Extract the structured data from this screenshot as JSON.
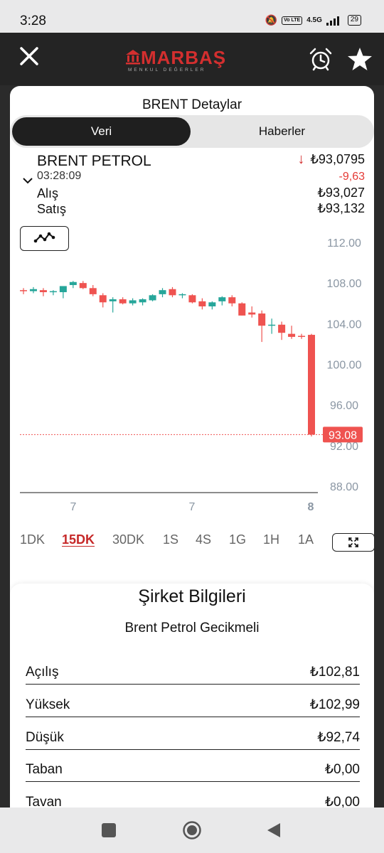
{
  "status_bar": {
    "time": "3:28",
    "network": "4.5G",
    "volte": "Vo LTE",
    "battery": "29"
  },
  "header": {
    "logo_text": "MARBAŞ",
    "logo_sub": "MENKUL DEĞERLER",
    "icons": [
      "close-icon",
      "alarm-clock-icon",
      "star-icon"
    ]
  },
  "sheet": {
    "title": "BRENT Detaylar",
    "tabs": [
      {
        "label": "Veri",
        "active": true
      },
      {
        "label": "Haberler",
        "active": false
      }
    ]
  },
  "quote": {
    "symbol": "BRENT PETROL",
    "time": "03:28:09",
    "price": "₺93,0795",
    "change": "-9,63",
    "alis_label": "Alış",
    "alis_value": "₺93,027",
    "satis_label": "Satış",
    "satis_value": "₺93,132"
  },
  "colors": {
    "up": "#26a69a",
    "down": "#ef5350",
    "accent_red": "#c62828"
  },
  "chart_data": {
    "type": "candlestick",
    "y_ticks": [
      "112.00",
      "108.00",
      "104.00",
      "100.00",
      "96.00",
      "92.00",
      "88.00"
    ],
    "ylim": [
      88,
      112
    ],
    "x_ticks": [
      "7",
      "7",
      "8"
    ],
    "last_price_label": "93.08",
    "last_price": 93.08,
    "candles": [
      {
        "o": 107.3,
        "h": 107.5,
        "l": 106.9,
        "c": 107.2
      },
      {
        "o": 107.2,
        "h": 107.6,
        "l": 107.0,
        "c": 107.4
      },
      {
        "o": 107.3,
        "h": 107.5,
        "l": 106.7,
        "c": 107.1
      },
      {
        "o": 107.1,
        "h": 107.3,
        "l": 106.8,
        "c": 107.2
      },
      {
        "o": 107.1,
        "h": 107.6,
        "l": 106.5,
        "c": 107.7
      },
      {
        "o": 107.8,
        "h": 108.2,
        "l": 107.5,
        "c": 108.1
      },
      {
        "o": 108.0,
        "h": 108.2,
        "l": 107.4,
        "c": 107.5
      },
      {
        "o": 107.5,
        "h": 107.8,
        "l": 106.7,
        "c": 106.9
      },
      {
        "o": 106.8,
        "h": 107.0,
        "l": 105.6,
        "c": 106.1
      },
      {
        "o": 106.2,
        "h": 106.6,
        "l": 105.1,
        "c": 106.4
      },
      {
        "o": 106.4,
        "h": 106.6,
        "l": 105.9,
        "c": 106.0
      },
      {
        "o": 106.0,
        "h": 106.5,
        "l": 105.8,
        "c": 106.3
      },
      {
        "o": 106.1,
        "h": 106.5,
        "l": 105.8,
        "c": 106.4
      },
      {
        "o": 106.3,
        "h": 106.9,
        "l": 106.2,
        "c": 106.8
      },
      {
        "o": 106.9,
        "h": 107.5,
        "l": 106.6,
        "c": 107.3
      },
      {
        "o": 107.4,
        "h": 107.6,
        "l": 106.6,
        "c": 106.8
      },
      {
        "o": 106.8,
        "h": 107.0,
        "l": 106.5,
        "c": 106.9
      },
      {
        "o": 106.8,
        "h": 106.9,
        "l": 106.0,
        "c": 106.1
      },
      {
        "o": 106.2,
        "h": 106.5,
        "l": 105.4,
        "c": 105.7
      },
      {
        "o": 105.7,
        "h": 106.2,
        "l": 105.4,
        "c": 106.1
      },
      {
        "o": 106.2,
        "h": 106.7,
        "l": 105.8,
        "c": 106.6
      },
      {
        "o": 106.6,
        "h": 106.8,
        "l": 105.7,
        "c": 106.0
      },
      {
        "o": 106.0,
        "h": 106.1,
        "l": 104.8,
        "c": 104.8
      },
      {
        "o": 105.1,
        "h": 105.7,
        "l": 104.6,
        "c": 104.9
      },
      {
        "o": 105.0,
        "h": 105.3,
        "l": 102.2,
        "c": 103.8
      },
      {
        "o": 103.9,
        "h": 104.5,
        "l": 103.0,
        "c": 103.9
      },
      {
        "o": 103.9,
        "h": 104.2,
        "l": 102.4,
        "c": 103.1
      },
      {
        "o": 103.0,
        "h": 103.8,
        "l": 102.5,
        "c": 102.7
      },
      {
        "o": 102.8,
        "h": 103.0,
        "l": 102.5,
        "c": 102.7
      },
      {
        "o": 102.9,
        "h": 103.0,
        "l": 92.9,
        "c": 93.08
      }
    ]
  },
  "timeframes": [
    {
      "label": "1DK",
      "active": false
    },
    {
      "label": "15DK",
      "active": true
    },
    {
      "label": "30DK",
      "active": false
    },
    {
      "label": "1S",
      "active": false
    },
    {
      "label": "4S",
      "active": false
    },
    {
      "label": "1G",
      "active": false
    },
    {
      "label": "1H",
      "active": false
    },
    {
      "label": "1A",
      "active": false
    }
  ],
  "company_info": {
    "title": "Şirket Bilgileri",
    "subtitle": "Brent Petrol Gecikmeli",
    "rows": [
      {
        "label": "Açılış",
        "value": "₺102,81"
      },
      {
        "label": "Yüksek",
        "value": "₺102,99"
      },
      {
        "label": "Düşük",
        "value": "₺92,74"
      },
      {
        "label": "Taban",
        "value": "₺0,00"
      },
      {
        "label": "Tavan",
        "value": "₺0,00"
      }
    ]
  }
}
